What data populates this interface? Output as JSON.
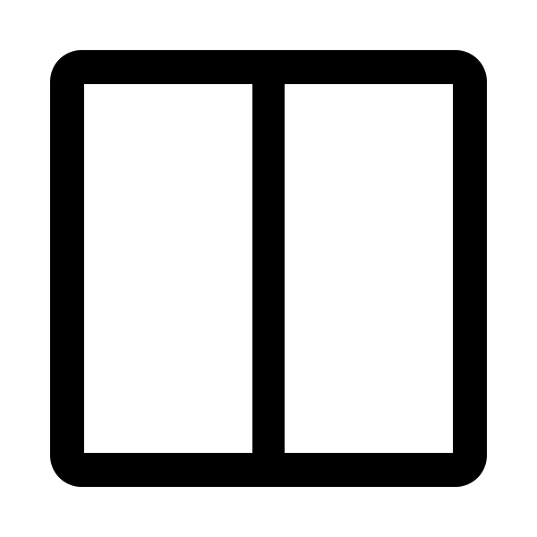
{
  "icon": {
    "name": "columns-split-icon",
    "stroke_color": "#000000",
    "background_color": "#ffffff"
  }
}
